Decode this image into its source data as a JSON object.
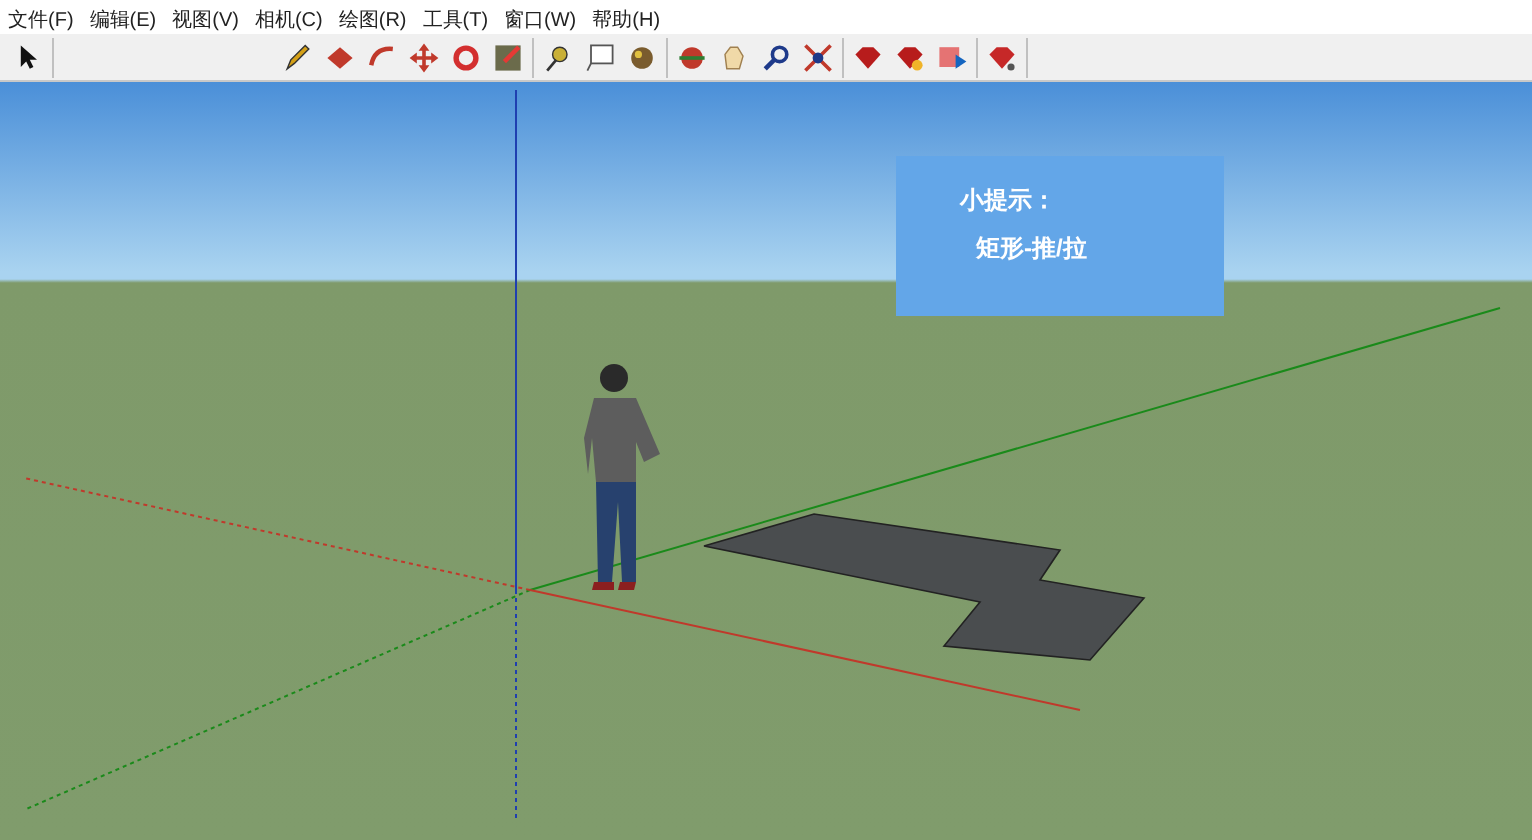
{
  "menu_bar": [
    "文件(F)",
    "编辑(E)",
    "视图(V)",
    "相机(C)",
    "绘图(R)",
    "工具(T)",
    "窗口(W)",
    "帮助(H)"
  ],
  "tip_box": {
    "title": "小提示：",
    "text": "矩形-推/拉"
  }
}
